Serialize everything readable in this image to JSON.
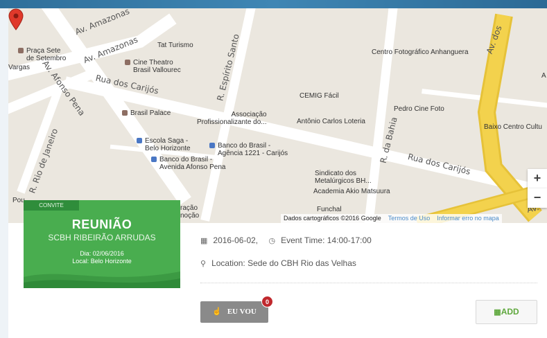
{
  "map": {
    "streets": {
      "av_amazonas_1": "Av. Amazonas",
      "av_amazonas_2": "Av. Amazonas",
      "av_afonso_pena_1": "Av. Afonso Pena",
      "rua_carijos_1": "Rua dos Carijós",
      "rua_carijos_2": "Rua dos Carijós",
      "r_espirito_santo": "R. Espírito Santo",
      "r_rio_janeiro": "R. Rio de Janeiro",
      "r_bahia": "R. da Bahia",
      "av_dos": "Av. dos",
      "av_right": "Av."
    },
    "places": {
      "praca_sete": "Praça Sete\nde Setembro",
      "vargas": "Vargas",
      "tat_turismo": "Tat Turismo",
      "cine_theatro": "Cine Theatro\nBrasil Vallourec",
      "centro_foto": "Centro Fotográfico",
      "anhanguera": "Anhanguera",
      "cemig": "CEMIG Fácil",
      "brasil_palace": "Brasil Palace",
      "associacao": "Associação\nProfissionalizante do...",
      "antonio_carlos": "Antônio Carlos Loteria",
      "pedro_cine": "Pedro Cine Foto",
      "baixo_centro": "Baixo Centro Cultu",
      "escola_saga": "Escola Saga -\nBelo Horizonte",
      "banco_carijos": "Banco do Brasil -\nAgência 1221 - Carijós",
      "banco_afonso": "Banco do Brasil -\nAvenida Afonso Pena",
      "sindicato": "Sindicato dos\nMetalúrgicos BH...",
      "academia": "Academia Akio Matsuura",
      "funchal": "Funchal",
      "racao": "ração\nnoção",
      "letter_a": "A",
      "pou": "Pou"
    },
    "zoom_in": "+",
    "zoom_out": "−",
    "attribution": "Dados cartográficos ©2016 Google",
    "terms": "Termos de Uso",
    "report": "Informar erro no mapa"
  },
  "invite": {
    "tag": "CONVITE",
    "title": "REUNIÃO",
    "subtitle": "SCBH RIBEIRÃO ARRUDAS",
    "date_line": "Dia: 02/06/2016",
    "place_line": "Local: Belo Horizonte"
  },
  "event": {
    "date": "2016-06-02,",
    "time": "Event Time: 14:00-17:00",
    "location": "Location: Sede do CBH Rio das Velhas"
  },
  "actions": {
    "going_label": "EU VOU",
    "going_count": "0",
    "add_label": "ADD"
  },
  "icons": {
    "calendar": "calendar-icon",
    "clock": "clock-icon",
    "marker": "map-marker-icon",
    "thumbs_up": "thumbs-up-icon"
  },
  "colors": {
    "invite_green": "#49ad4f",
    "badge_red": "#c0282d",
    "add_green": "#5fa83d",
    "road_yellow": "#f3d24d"
  }
}
